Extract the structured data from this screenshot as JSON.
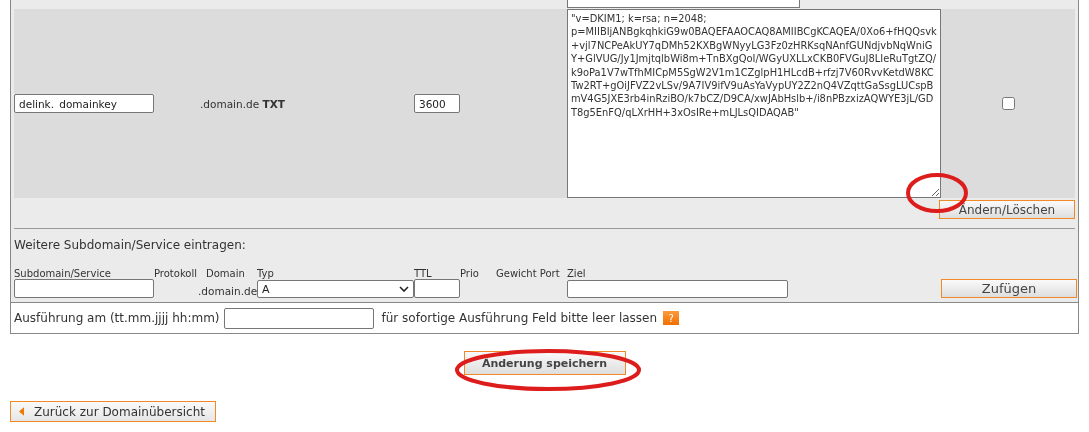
{
  "records": [
    {
      "subdomain": "delink._domainkey",
      "domain": ".domain.de",
      "type": "TXT",
      "ttl": "3600",
      "value": "\"v=DKIM1; k=rsa; n=2048;\np=MIIBIjANBgkqhkiG9w0BAQEFAAOCAQ8AMIIBCgKCAQEA/0Xo6+fHQQsvk+vjl7NCPeAkUY7qDMh52KXBgWNyyLG3Fz0zHRKsqNAnfGUNdjvbNqWniGY+GlVUG/Jy1JmjtqlbWi8m+TnBXgQoI/WGyUXLLxCKB0FVGuJ8LIeRuTgtZQ/k9oPa1V7wTfhMICpM5SgW2V1m1CZglpH1HLcdB+rfzj7V60RvvKetdW8KCTw2RT+gOiJFVZ2vLSv/9A7IV9ifV9uAsYaVypUY2Z2nQ4VZqttGaSsgLUCspBmV4G5JXE3rb4inRziBO/k7bCZ/D9CA/xwJAbHslb+/i8nPBzxizAQWYE3jL/GDT8g5EnFQ/qLXrHH+3xOsIRe+mLJLsQIDAQAB\"",
      "checked": false
    }
  ],
  "update_button": "Ändern/Löschen",
  "new_entry": {
    "heading": "Weitere Subdomain/Service eintragen:",
    "columns": [
      "Subdomain/Service",
      "Protokoll",
      "Domain",
      "Typ",
      "TTL",
      "Prio",
      "Gewicht Port",
      "Ziel"
    ],
    "domain": ".domain.de",
    "type": "A",
    "button": "Zufügen"
  },
  "schedule": {
    "label": "Ausführung am (tt.mm.jjjj hh:mm)",
    "hint": "für sofortige Ausführung Feld bitte leer lassen",
    "help": "?"
  },
  "save_button": "Änderung speichern",
  "back_link": "Zurück zur Domainübersicht"
}
